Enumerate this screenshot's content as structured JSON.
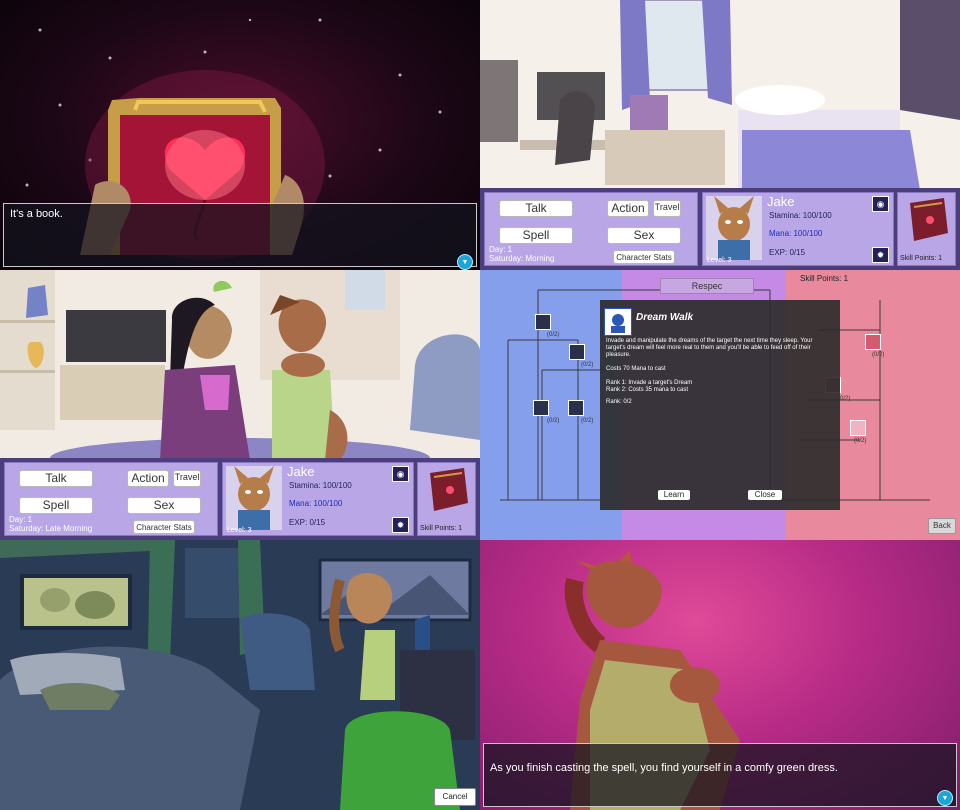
{
  "panel1": {
    "dialogue": "It's a book."
  },
  "hud": {
    "buttons": {
      "talk": "Talk",
      "action": "Action",
      "travel": "Travel",
      "spell": "Spell",
      "sex": "Sex",
      "character_stats": "Character Stats"
    },
    "panel2": {
      "day": "Day: 1",
      "time": "Saturday: Morning"
    },
    "panel3": {
      "day": "Day: 1",
      "time": "Saturday: Late Morning"
    },
    "character": {
      "name": "Jake",
      "stamina": "Stamina: 100/100",
      "mana": "Mana: 100/100",
      "exp": "EXP: 0/15",
      "level": "Level: 3"
    },
    "skill_points": "Skill Points: 1"
  },
  "skill_tree": {
    "respec_label": "Respec",
    "skill_points": "Skill Points: 1",
    "back_label": "Back",
    "node_rank": "(0/2)",
    "popup": {
      "title": "Dream Walk",
      "description": "Invade and manipulate the dreams of the target the next time they sleep. Your target's dream will feel more real to them and you'll be able to feed off of their pleasure.",
      "cost": "Costs 70 Mana to cast",
      "rank1": "Rank 1:  Invade a target's Dream",
      "rank2": "Rank 2:  Costs 35 mana to cast",
      "rank": "Rank:  0/2",
      "learn_label": "Learn",
      "close_label": "Close"
    }
  },
  "panel5": {
    "cancel_label": "Cancel"
  },
  "panel6": {
    "dialogue": "As you finish casting the spell, you find yourself in a comfy green dress."
  },
  "colors": {
    "hud_bg": "#b9a6e6",
    "tree_blue": "#869fed",
    "tree_purple": "#c48ae5",
    "tree_red": "#e9899d",
    "advance_icon": "#1aa7d6"
  }
}
